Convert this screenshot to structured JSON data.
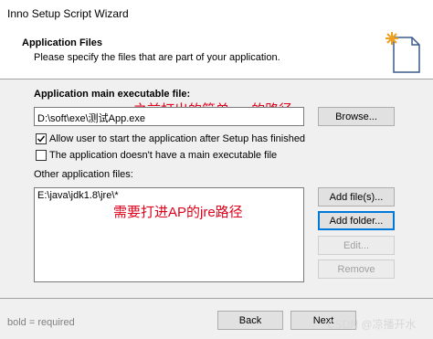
{
  "window": {
    "title": "Inno Setup Script Wizard"
  },
  "header": {
    "title": "Application Files",
    "subtitle": "Please specify the files that are part of your application."
  },
  "main_exe": {
    "label": "Application main executable file:",
    "value": "D:\\soft\\exe\\测试App.exe",
    "browse_label": "Browse..."
  },
  "checkboxes": [
    {
      "label": "Allow user to start the application after Setup has finished",
      "checked": true
    },
    {
      "label": "The application doesn't have a main executable file",
      "checked": false
    }
  ],
  "other_files": {
    "label": "Other application files:",
    "items": [
      "E:\\java\\jdk1.8\\jre\\*"
    ],
    "buttons": {
      "add_files": "Add file(s)...",
      "add_folder": "Add folder...",
      "edit": "Edit...",
      "remove": "Remove"
    }
  },
  "annotations": {
    "exe_note": "之前打出的简单exe的路径",
    "jre_note": "需要打进AP的jre路径"
  },
  "footer": {
    "legend": "bold = required",
    "back_label": "Back",
    "next_label": "Next",
    "watermark": "CSDN @凉播开水"
  },
  "colors": {
    "annotation": "#e0001b",
    "focus": "#0078d7"
  }
}
